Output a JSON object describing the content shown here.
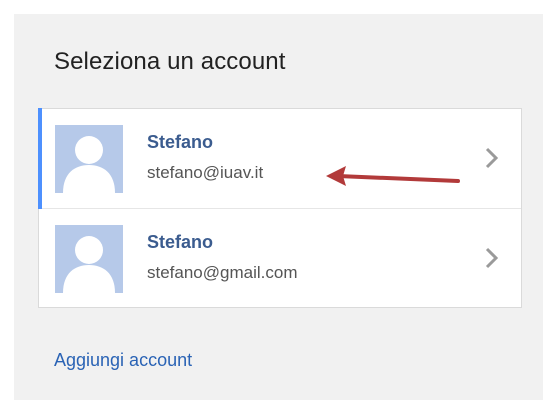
{
  "dialog": {
    "title": "Seleziona un account",
    "add_account_label": "Aggiungi account"
  },
  "accounts": [
    {
      "name": "Stefano",
      "email": "stefano@iuav.it",
      "selected": true
    },
    {
      "name": "Stefano",
      "email": "stefano@gmail.com",
      "selected": false
    }
  ],
  "icons": {
    "avatar": "default-user-silhouette-icon",
    "chevron": "chevron-right-icon"
  },
  "colors": {
    "accent": "#4d90fe",
    "name_text": "#3b5c8f",
    "link": "#2a63b5",
    "annotation_arrow": "#b23a3a"
  }
}
